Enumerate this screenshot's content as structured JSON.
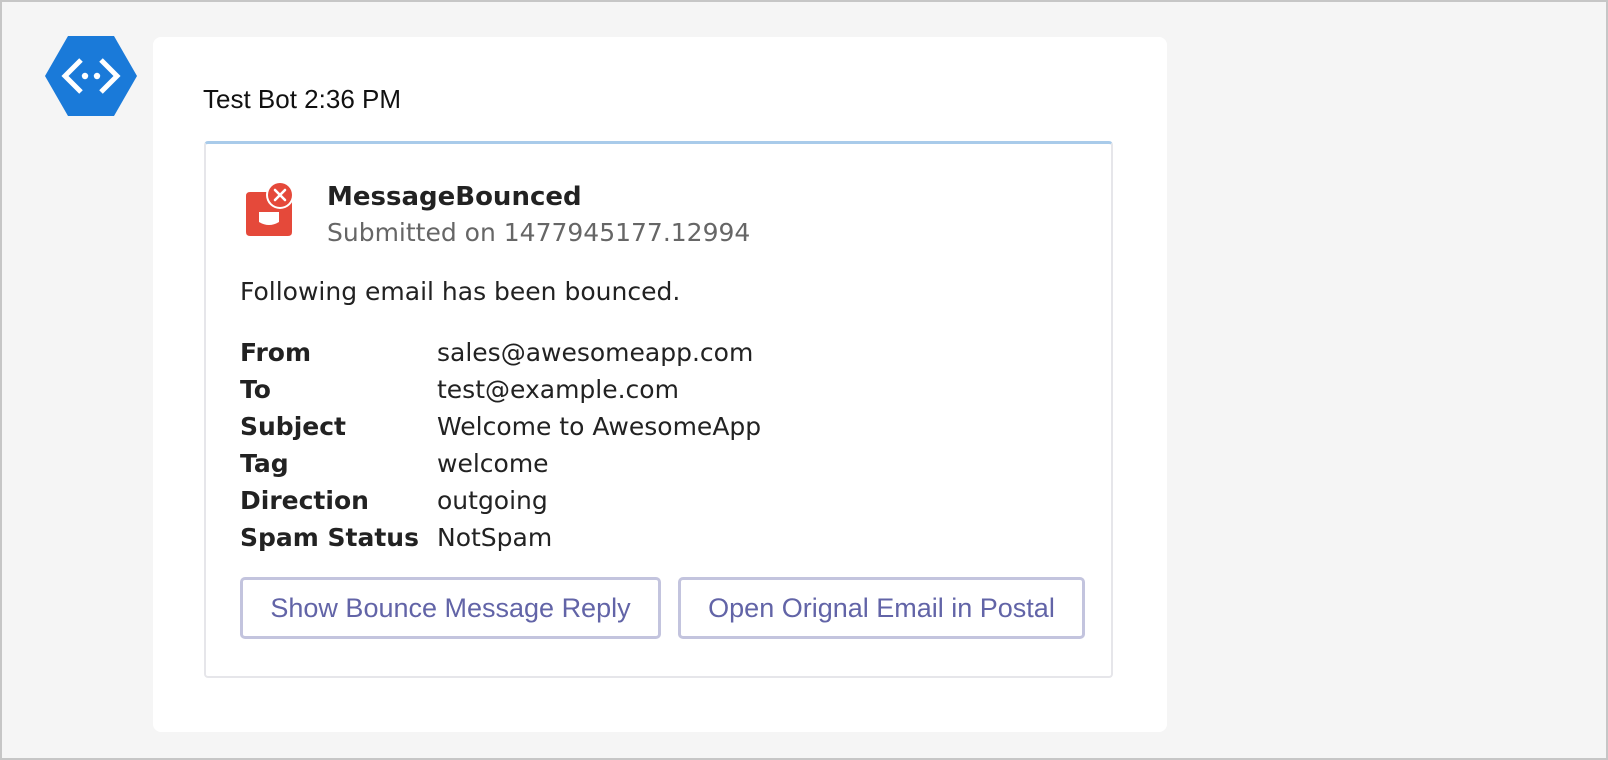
{
  "bot": {
    "avatar_icon": "bot-diamond-icon",
    "name": "Test Bot",
    "time": "2:36 PM",
    "accent_color": "#1a7ad9"
  },
  "card": {
    "icon": "mailbox-error-icon",
    "icon_color": "#e5493a",
    "title": "MessageBounced",
    "subtitle": "Submitted on 1477945177.12994",
    "text": "Following email has been bounced.",
    "facts": [
      {
        "label": "From",
        "value": "sales@awesomeapp.com"
      },
      {
        "label": "To",
        "value": "test@example.com"
      },
      {
        "label": "Subject",
        "value": "Welcome to AwesomeApp"
      },
      {
        "label": "Tag",
        "value": "welcome"
      },
      {
        "label": "Direction",
        "value": "outgoing"
      },
      {
        "label": "Spam Status",
        "value": "NotSpam"
      }
    ],
    "actions": [
      {
        "label": "Show Bounce Message Reply"
      },
      {
        "label": "Open Orignal Email in Postal"
      }
    ]
  }
}
